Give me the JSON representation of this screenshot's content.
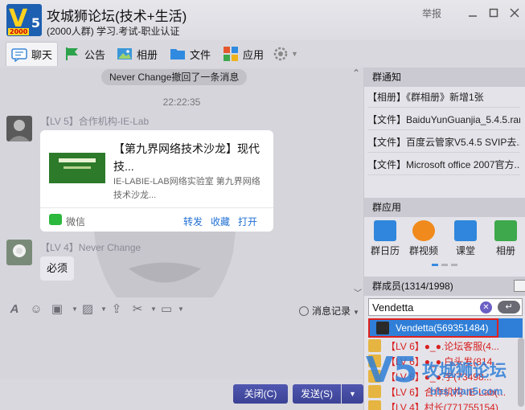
{
  "window": {
    "group_name": "攻城狮论坛(技术+生活)",
    "group_desc": "(2000人群) 学习.考试-职业认证",
    "report_label": "举报",
    "logo": {
      "year": "2000",
      "letter": "V",
      "number": "5"
    }
  },
  "tabs": [
    {
      "label": "聊天",
      "icon": "chat-icon",
      "color": "#3a86d8"
    },
    {
      "label": "公告",
      "icon": "flag-icon",
      "color": "#2ca24a"
    },
    {
      "label": "相册",
      "icon": "photo-icon",
      "color": "#3c97d8"
    },
    {
      "label": "文件",
      "icon": "folder-icon",
      "color": "#2f8ae0"
    },
    {
      "label": "应用",
      "icon": "apps-icon",
      "color": "#e4572e"
    }
  ],
  "chat": {
    "system_notice": "Never Change撤回了一条消息",
    "timestamp": "22:22:35",
    "msg1": {
      "sender": "【LV 5】合作机构-IE-Lab",
      "card_title": "【第九界网络技术沙龙】现代技...",
      "card_subtitle": "IE-LABIE-LAB网络实验室 第九界网络技术沙龙...",
      "card_source": "微信",
      "actions": [
        "转发",
        "收藏",
        "打开"
      ]
    },
    "msg2": {
      "sender": "【LV 4】Never Change",
      "text": "必须"
    }
  },
  "toolbar": {
    "history_label": "消息记录"
  },
  "buttons": {
    "close_label": "关闭(C)",
    "send_label": "发送(S)",
    "send_dropdown": "▼"
  },
  "right_panel": {
    "notice_header": "群通知",
    "notices": [
      "【相册】《群相册》新增1张",
      "【文件】BaiduYunGuanjia_5.4.5.rar",
      "【文件】百度云管家V5.4.5 SVIP去...",
      "【文件】Microsoft office 2007官方..."
    ],
    "apps_header": "群应用",
    "apps": [
      {
        "label": "群日历",
        "color": "#2f86dc"
      },
      {
        "label": "群视频",
        "color": "#f08a1c"
      },
      {
        "label": "课堂",
        "color": "#2f86dc"
      },
      {
        "label": "相册",
        "color": "#3da84c"
      }
    ],
    "members_header": "群成员(1314/1998)",
    "search_value": "Vendetta",
    "result": "Vendetta(569351484)",
    "members": [
      "【LV 6】●_●.论坛客服(4...",
      "【LV 6】●_●.白头发(814...",
      "【LV 6】●_●.宇(73498...",
      "【LV 6】合作机构-IE-Lab(...",
      "【LV 4】村长(771755154)"
    ]
  },
  "watermark": {
    "brand": "攻城狮论坛",
    "url": "bbs.vlan5.com"
  }
}
